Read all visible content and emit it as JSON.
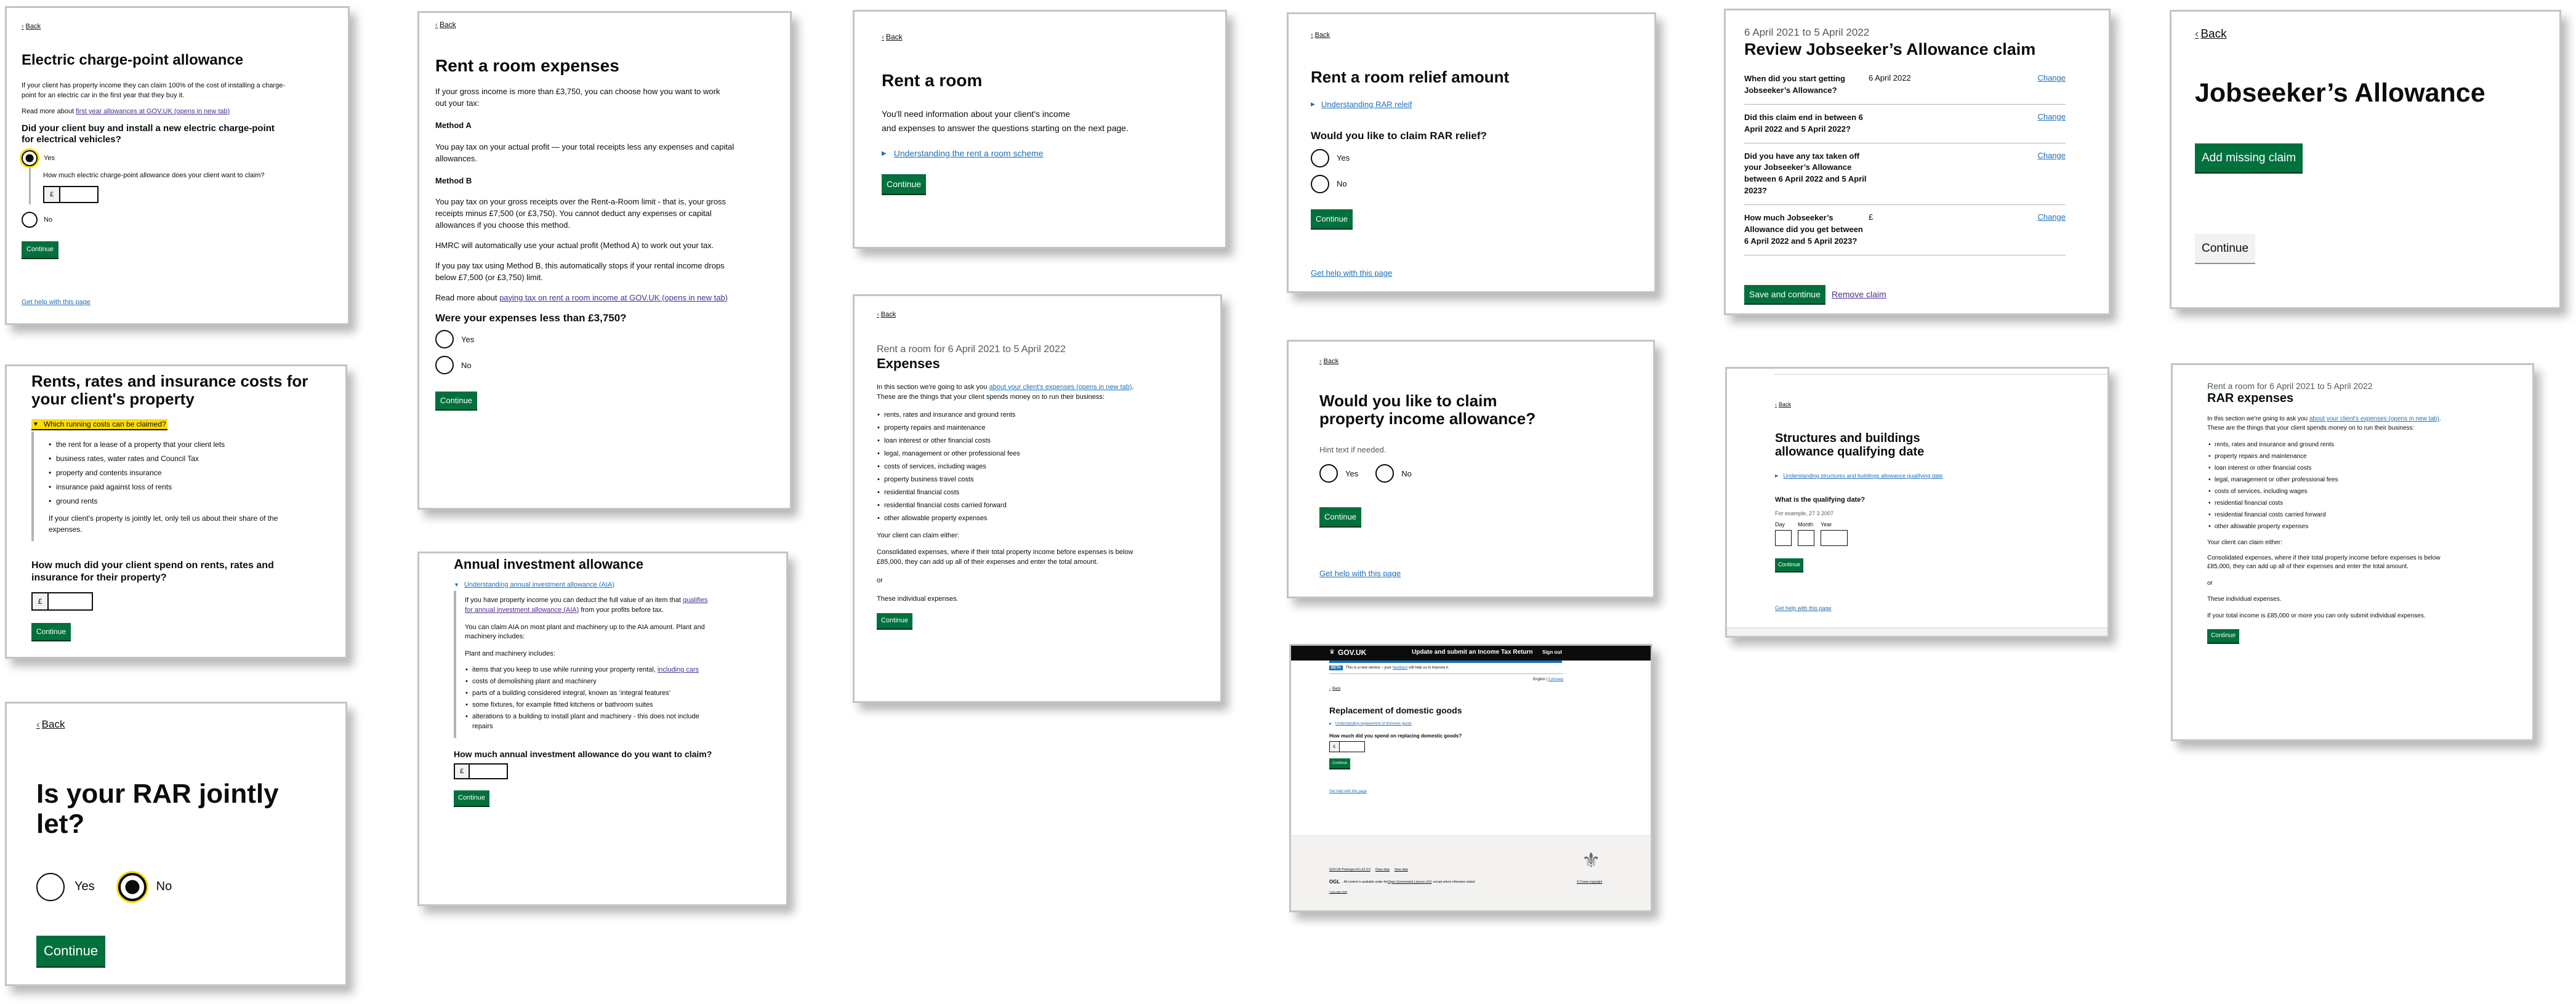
{
  "common": {
    "back": "Back",
    "continue": "Continue",
    "help_link": "Get help with this page",
    "yes": "Yes",
    "no": "No",
    "currency_prefix": "£"
  },
  "electric_charge_point": {
    "title": "Electric charge-point allowance",
    "intro": "If your client has property income they can claim 100% of the cost of installing a charge-point for an electric car in the first year that they buy it.",
    "read_more_prefix": "Read more about ",
    "read_more_link": "first year allowances at GOV.UK (opens in new tab)",
    "question": "Did your client buy and install a new electric charge-point for electrical vehicles?",
    "selected": "Yes",
    "conditional_label": "How much electric charge-point allowance does your client want to claim?",
    "amount_value": ""
  },
  "rents_rates": {
    "title": "Rents, rates and insurance costs for your client's property",
    "details_summary": "Which running costs can be claimed?",
    "details_items": [
      "the rent for a lease of a property that your client lets",
      "business rates, water rates and Council Tax",
      "property and contents insurance",
      "insurance paid against loss of rents",
      "ground rents"
    ],
    "details_note": "If your client's property is jointly let, only tell us about their share of the expenses.",
    "question": "How much did your client spend on rents, rates and insurance for their property?",
    "amount_value": ""
  },
  "rar_jointly": {
    "title": "Is your RAR jointly let?",
    "selected": "No"
  },
  "rent_room_expenses": {
    "title": "Rent a room expenses",
    "intro": "If your gross income is more than £3,750, you can choose how you want to work out your tax:",
    "method_a_heading": "Method A",
    "method_a_text": "You pay tax on your actual profit — your total receipts less any expenses and capital allowances.",
    "method_b_heading": "Method B",
    "method_b_text": "You pay tax on your gross receipts over the Rent-a-Room limit - that is, your gross receipts minus £7,500 (or £3,750). You cannot deduct any expenses or capital allowances if you choose this method.",
    "hmrc_text": "HMRC will automatically use your actual profit (Method A) to work out your tax.",
    "method_b_stop": "If you pay tax using Method B, this automatically stops if your rental income drops below £7,500 (or £3,750) limit.",
    "read_more_prefix": "Read more about ",
    "read_more_link": "paying tax on rent a room income at GOV.UK (opens in new tab)",
    "question": "Were your expenses less than £3,750?"
  },
  "aia": {
    "title": "Annual investment allowance",
    "details_summary": "Understanding annual investment allowance (AIA)",
    "para1_prefix": "If you have property income you can deduct the full value of an item that ",
    "para1_link": "qualifies for annual investment allowance (AIA)",
    "para1_suffix": " from your profits before tax.",
    "para2": "You can claim AIA on most plant and machinery up to the AIA amount. Plant and machinery includes:",
    "para3": "Plant and machinery includes:",
    "item1_prefix": "items that you keep to use while running your property rental, ",
    "item1_link": "including cars",
    "items": [
      "costs of demolishing plant and machinery",
      "parts of a building considered integral, known as ‘integral features’",
      "some fixtures, for example fitted kitchens or bathroom suites",
      "alterations to a building to install plant and machinery - this does not include repairs"
    ],
    "question": "How much annual investment allowance do you want to claim?",
    "amount_value": ""
  },
  "rent_a_room": {
    "title": "Rent a room",
    "intro_line1": "You'll need information about your client's income",
    "intro_line2": "and expenses to answer the questions starting on the next page.",
    "details_summary": "Understanding the rent a room scheme"
  },
  "expenses": {
    "caption": "Rent a room for 6 April 2021 to 5 April 2022",
    "title": "Expenses",
    "intro_prefix": "In this section we're going to ask you ",
    "intro_link": "about your client's expenses (opens in new tab)",
    "intro_suffix": ". These are the things that your client spends money on to run their business:",
    "items": [
      "rents, rates and insurance and ground rents",
      "property repairs and maintenance",
      "loan interest or other financial costs",
      "legal, management or other professional fees",
      "costs of services, including wages",
      "property business travel costs",
      "residential financial costs",
      "residential financial costs carried forward",
      "other allowable property expenses"
    ],
    "claim_either": "Your client can claim either:",
    "consolidated": "Consolidated expenses, where if their total property income before expenses is below £85,000, they can add up all of their expenses and enter the total amount.",
    "or": "or",
    "individual": "These individual expenses."
  },
  "rar_relief": {
    "title": "Rent a room relief amount",
    "details_summary": "Understanding RAR releif",
    "question": "Would you like to claim RAR relief?"
  },
  "property_income_allowance": {
    "title": "Would you like to claim property income allowance?",
    "hint": "Hint text if needed."
  },
  "domestic_goods": {
    "header_logo": "GOV.UK",
    "header_service": "Update and submit an Income Tax Return",
    "header_signout": "Sign out",
    "beta_tag": "BETA",
    "beta_prefix": "This is a new service – your ",
    "beta_link": "feedback",
    "beta_suffix": " will help us to improve it.",
    "lang_english": "English",
    "lang_welsh": "Cymraeg",
    "title": "Replacement of domestic goods",
    "details_summary": "Understanding replacement of domestic goods",
    "question": "How much did you spend on replacing domestic goods?",
    "amount_value": "",
    "footer_links": [
      "GOV.UK Prototype Kit v12.3.0",
      "Clear data",
      "View data"
    ],
    "ogl_logo": "OGL",
    "licence_prefix": "All content is available under the ",
    "licence_link": "Open Government Licence v3.0",
    "licence_suffix": ", except where otherwise stated",
    "copy_page_state": "Copy page state",
    "crown_copyright": "© Crown copyright"
  },
  "review_jsa": {
    "caption": "6 April 2021 to 5 April 2022",
    "title": "Review Jobseeker’s Allowance claim",
    "rows": [
      {
        "key": "When did you start getting Jobseeker’s Allowance?",
        "value": "6 April 2022",
        "action": "Change"
      },
      {
        "key": "Did this claim end in between 6 April 2022 and 5 April 2022?",
        "value": "",
        "action": "Change"
      },
      {
        "key": "Did you have any tax taken off your Jobseeker’s Allowance between 6 April 2022 and 5 April 2023?",
        "value": "",
        "action": "Change"
      },
      {
        "key": "How much Jobseeker’s Allowance did you get between 6 April 2022 and 5 April 2023?",
        "value": "£",
        "action": "Change"
      }
    ],
    "save_button": "Save and continue",
    "remove_link": "Remove claim"
  },
  "structures_buildings": {
    "title": "Structures and buildings allowance qualifying date",
    "details_summary": "Understanding structures and buildings allowance qualifying date",
    "question": "What is the qualifying date?",
    "hint": "For example, 27 3 2007",
    "day_label": "Day",
    "month_label": "Month",
    "year_label": "Year",
    "day_value": "",
    "month_value": "",
    "year_value": ""
  },
  "jsa": {
    "title": "Jobseeker’s Allowance",
    "add_button": "Add missing claim"
  },
  "rar_expenses": {
    "caption": "Rent a room for 6 April 2021 to 5 April 2022",
    "title": "RAR expenses",
    "intro_prefix": "In this section we're going to ask you ",
    "intro_link": "about your client's expenses (opens in new tab)",
    "intro_suffix": ". These are the things that your client spends money on to run their business:",
    "items": [
      "rents, rates and insurance and ground rents",
      "property repairs and maintenance",
      "loan interest or other financial costs",
      "legal, management or other professional fees",
      "costs of services, including wages",
      "residential financial costs",
      "residential financial costs carried forward",
      "other allowable property expenses"
    ],
    "claim_either": "Your client can claim either:",
    "consolidated": "Consolidated expenses, where if their total property income before expenses is below £85,000, they can add up all of their expenses and enter the total amount.",
    "or": "or",
    "individual": "These individual expenses.",
    "limit_note": "If your total income is £85,000 or more you can only submit individual expenses."
  }
}
